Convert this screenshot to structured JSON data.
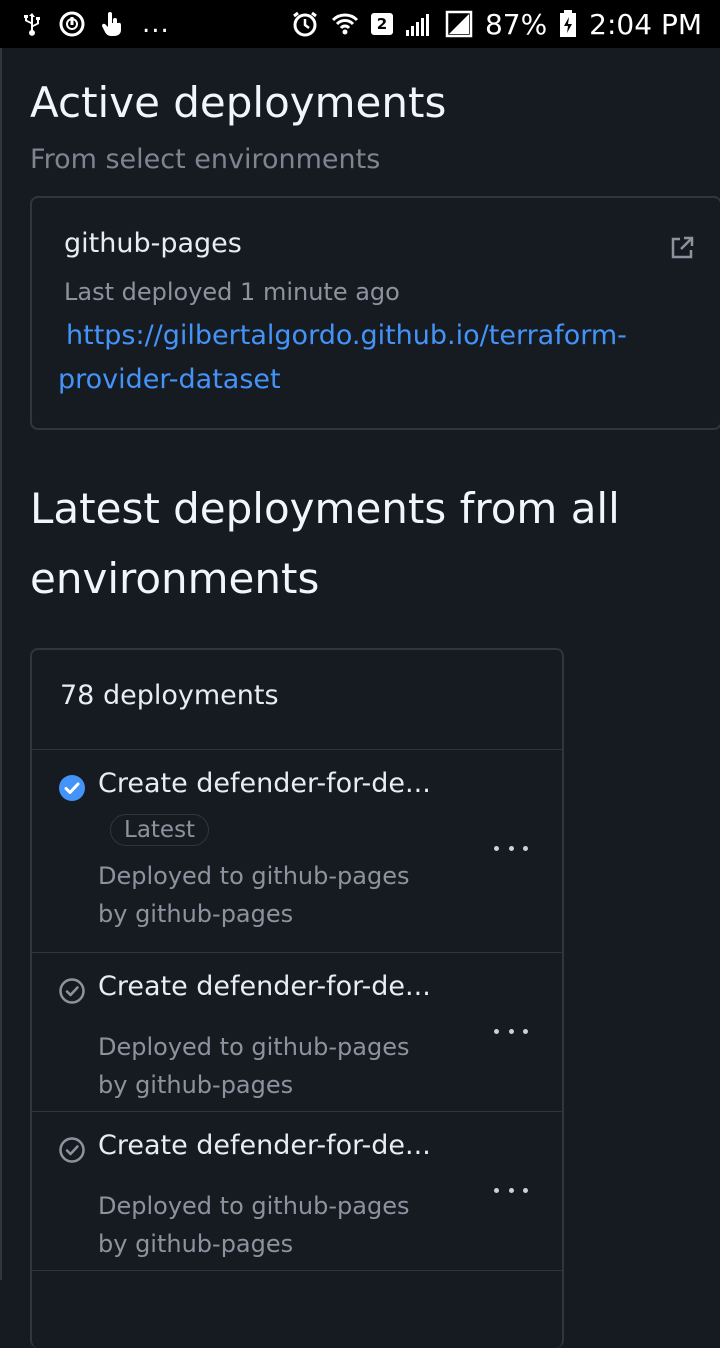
{
  "status_bar": {
    "left_icons": [
      "usb-debug-icon",
      "power-sync-icon",
      "touch-icon"
    ],
    "overflow": "...",
    "wifi_sim": "2",
    "battery_percent": "87%",
    "time": "2:04 PM"
  },
  "active": {
    "title": "Active deployments",
    "subtitle": "From select environments",
    "card": {
      "environment": "github-pages",
      "last_deployed": "Last deployed 1 minute ago",
      "url": "https://gilbertalgordo.github.io/terraform-provider-dataset"
    }
  },
  "latest": {
    "title": "Latest deployments from all environments",
    "count_label": "78 deployments",
    "items": [
      {
        "title": "Create defender-for-de...",
        "badge": "Latest",
        "line1": "Deployed to github-pages",
        "line2": "by github-pages",
        "status": "success"
      },
      {
        "title": "Create defender-for-de...",
        "line1": "Deployed to github-pages",
        "line2": "by github-pages",
        "status": "inactive"
      },
      {
        "title": "Create defender-for-de...",
        "line1": "Deployed to github-pages",
        "line2": "by github-pages",
        "status": "inactive"
      }
    ]
  },
  "colors": {
    "background": "#161b22",
    "link": "#4493f8",
    "success": "#4493f8",
    "border": "#30363d"
  }
}
